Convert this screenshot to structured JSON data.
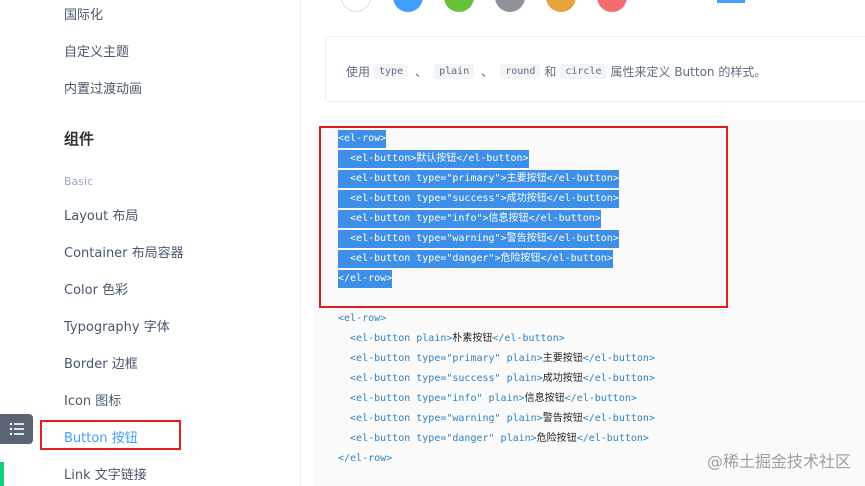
{
  "sidebar": {
    "items_top": [
      "国际化",
      "自定义主题",
      "内置过渡动画"
    ],
    "group_title": "组件",
    "subgroup": "Basic",
    "items": [
      "Layout 布局",
      "Container 布局容器",
      "Color 色彩",
      "Typography 字体",
      "Border 边框",
      "Icon 图标",
      "Button 按钮",
      "Link 文字链接"
    ],
    "active_item": "Button 按钮"
  },
  "colors": {
    "accent": "#409eff",
    "highlight": "#3d8fe8",
    "annotation_red": "#e02020",
    "circles": [
      "#ffffff",
      "#409eff",
      "#67c23a",
      "#909399",
      "#e6a23c",
      "#f56c6c"
    ]
  },
  "description": {
    "prefix": "使用",
    "code1": "type",
    "sep1": "、",
    "code2": "plain",
    "sep2": "、",
    "code3": "round",
    "and": "和",
    "code4": "circle",
    "suffix": "属性来定义 Button 的样式。"
  },
  "code_block": {
    "lines": [
      {
        "code": "<el-row>",
        "zh": "",
        "tail": "",
        "selected": true
      },
      {
        "code": "  <el-button>",
        "zh": "默认按钮",
        "tail": "</el-button>",
        "selected": true
      },
      {
        "code": "  <el-button type=\"primary\">",
        "zh": "主要按钮",
        "tail": "</el-button>",
        "selected": true
      },
      {
        "code": "  <el-button type=\"success\">",
        "zh": "成功按钮",
        "tail": "</el-button>",
        "selected": true
      },
      {
        "code": "  <el-button type=\"info\">",
        "zh": "信息按钮",
        "tail": "</el-button>",
        "selected": true
      },
      {
        "code": "  <el-button type=\"warning\">",
        "zh": "警告按钮",
        "tail": "</el-button>",
        "selected": true
      },
      {
        "code": "  <el-button type=\"danger\">",
        "zh": "危险按钮",
        "tail": "</el-button>",
        "selected": true
      },
      {
        "code": "</el-row>",
        "zh": "",
        "tail": "",
        "selected": true
      },
      {
        "code": "",
        "zh": "",
        "tail": "",
        "selected": false
      },
      {
        "code": "<el-row>",
        "zh": "",
        "tail": "",
        "selected": false
      },
      {
        "code": "  <el-button plain>",
        "zh": "朴素按钮",
        "tail": "</el-button>",
        "selected": false
      },
      {
        "code": "  <el-button type=\"primary\" plain>",
        "zh": "主要按钮",
        "tail": "</el-button>",
        "selected": false
      },
      {
        "code": "  <el-button type=\"success\" plain>",
        "zh": "成功按钮",
        "tail": "</el-button>",
        "selected": false
      },
      {
        "code": "  <el-button type=\"info\" plain>",
        "zh": "信息按钮",
        "tail": "</el-button>",
        "selected": false
      },
      {
        "code": "  <el-button type=\"warning\" plain>",
        "zh": "警告按钮",
        "tail": "</el-button>",
        "selected": false
      },
      {
        "code": "  <el-button type=\"danger\" plain>",
        "zh": "危险按钮",
        "tail": "</el-button>",
        "selected": false
      },
      {
        "code": "</el-row>",
        "zh": "",
        "tail": "",
        "selected": false
      }
    ]
  },
  "watermark": "@稀土掘金技术社区"
}
